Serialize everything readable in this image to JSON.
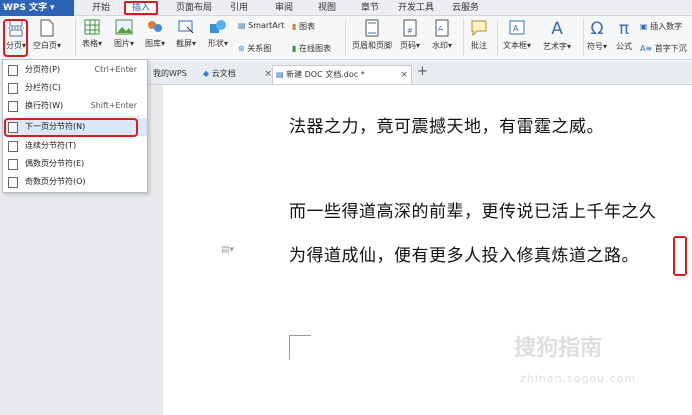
{
  "app": {
    "logo": "WPS 文字",
    "logo_arrow": "▾"
  },
  "menubar": {
    "items": [
      "开始",
      "插入",
      "页面布局",
      "引用",
      "审阅",
      "视图",
      "章节",
      "开发工具",
      "云服务"
    ],
    "active": "插入"
  },
  "ribbon": {
    "page_break": "分页",
    "blank_page": "空白页",
    "table": "表格",
    "picture": "图片",
    "gallery": "图库",
    "screenshot": "截屏",
    "shapes": "形状",
    "relation": "关系图",
    "smartart": "SmartArt",
    "chart": "图表",
    "online_chart": "在线图表",
    "header_footer": "页眉和页脚",
    "page_number": "页码",
    "watermark": "水印",
    "comment": "批注",
    "textbox": "文本框",
    "wordart": "艺术字",
    "symbol": "符号",
    "formula": "公式",
    "insert_number": "插入数字",
    "dropcap": "首字下沉"
  },
  "tabs": [
    {
      "label": "我的WPS"
    },
    {
      "label": "云文档"
    },
    {
      "label": "新建 DOC 文档.doc *"
    }
  ],
  "tab_add": "+",
  "tab_close": "×",
  "dropdown": {
    "items": [
      {
        "label": "分页符(P)",
        "shortcut": "Ctrl+Enter"
      },
      {
        "label": "分栏符(C)",
        "shortcut": ""
      },
      {
        "label": "换行符(W)",
        "shortcut": "Shift+Enter"
      },
      {
        "label": "下一页分节符(N)",
        "shortcut": ""
      },
      {
        "label": "连续分节符(T)",
        "shortcut": ""
      },
      {
        "label": "偶数页分节符(E)",
        "shortcut": ""
      },
      {
        "label": "奇数页分节符(O)",
        "shortcut": ""
      }
    ]
  },
  "document": {
    "lines": [
      "法器之力，竟可震撼天地，有雷霆之威。",
      "而一些得道高深的前辈，更传说已活上千年之久",
      "为得道成仙，便有更多人投入修真炼道之路。"
    ]
  },
  "watermark": {
    "text": "搜狗指南",
    "sub": "zhinan.sogou.com"
  }
}
